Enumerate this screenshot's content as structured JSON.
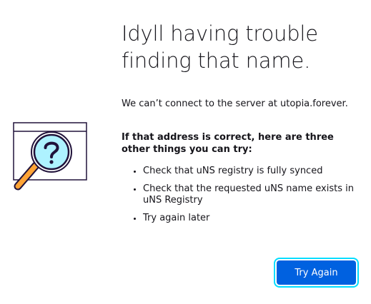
{
  "page": {
    "title": "Idyll having trouble finding that name.",
    "description": "We can’t connect to the server at utopia.forever.",
    "suggestions_heading": "If that address is correct, here are three other things you can try:",
    "suggestions": [
      "Check that uNS registry is fully synced",
      "Check that the requested uNS name exists in uNS Registry",
      "Try again later"
    ],
    "try_again_label": "Try Again"
  },
  "illustration": {
    "icon": "magnifying-glass-question-icon"
  },
  "colors": {
    "accent": "#0061e0",
    "focus_ring": "#00ddff",
    "illustration_stroke": "#20123a",
    "lens_fill": "#aef2ff",
    "handle": "#ffa436",
    "text": "#15141a"
  }
}
